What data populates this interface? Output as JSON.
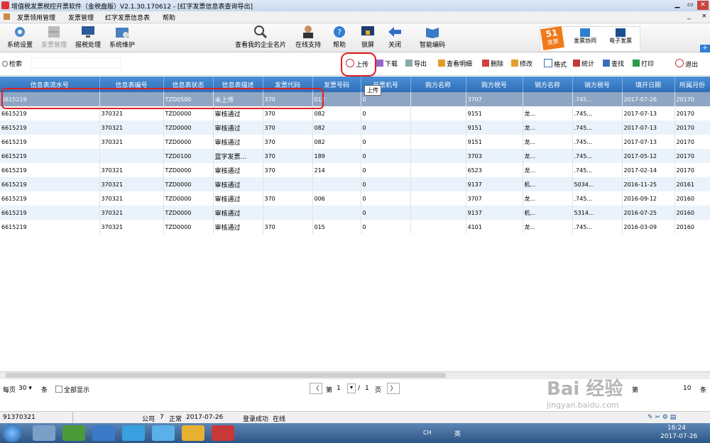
{
  "window": {
    "title": "增值税发票税控开票软件（金税盘版）V2.1.30.170612 - [红字发票信息表查询导出]"
  },
  "menu": [
    "发票领用管理",
    "发票管理",
    "红字发票信息表",
    "帮助"
  ],
  "toolbar": {
    "items": [
      "系统设置",
      "发票管理",
      "报税处理",
      "系统维护"
    ],
    "company_lookup": "查看我的企业名片",
    "right_items": [
      "在线支持",
      "帮助",
      "锁屏",
      "关闭",
      "智能编码"
    ],
    "promo": {
      "badge": "51",
      "badge_sub": "发票",
      "items": [
        "发票协同",
        "电子发票"
      ]
    }
  },
  "search": {
    "label": "检索"
  },
  "actions": {
    "upload": "上传",
    "download": "下载",
    "export": "导出",
    "view_detail": "查看明细",
    "delete": "删除",
    "edit": "修改",
    "format": "格式",
    "stats": "统计",
    "find": "查找",
    "print": "打印",
    "exit": "退出"
  },
  "tooltip": "上传",
  "table": {
    "columns": [
      "信息表流水号",
      "信息表编号",
      "信息表状态",
      "信息表描述",
      "发票代码",
      "发票号码",
      "开票机号",
      "购方名称",
      "购方税号",
      "销方名称",
      "销方税号",
      "填开日期",
      "所属月份"
    ],
    "rows": [
      [
        "6615219",
        "",
        "TZD0500",
        "未上传",
        "370",
        "012",
        "0",
        "",
        "3707",
        "",
        ".745...",
        "2017-07-26",
        "20170"
      ],
      [
        "6615219",
        "370321",
        "TZD0000",
        "审核通过",
        "370",
        "082",
        "0",
        "",
        "9151",
        "龙...",
        ".745...",
        "2017-07-13",
        "20170"
      ],
      [
        "6615219",
        "370321",
        "TZD0000",
        "审核通过",
        "370",
        "082",
        "0",
        "",
        "9151",
        "龙...",
        ".745...",
        "2017-07-13",
        "20170"
      ],
      [
        "6615219",
        "370321",
        "TZD0000",
        "审核通过",
        "370",
        "082",
        "0",
        "",
        "9151",
        "龙...",
        ".745...",
        "2017-07-13",
        "20170"
      ],
      [
        "6615219",
        "",
        "TZD0100",
        "蓝字发票...",
        "370",
        "189",
        "0",
        "",
        "3703",
        "龙...",
        ".745...",
        "2017-05-12",
        "20170"
      ],
      [
        "6615219",
        "370321",
        "TZD0000",
        "审核通过",
        "370",
        "214",
        "0",
        "",
        "6523",
        "龙...",
        ".745...",
        "2017-02-14",
        "20170"
      ],
      [
        "6615219",
        "370321",
        "TZD0000",
        "审核通过",
        "",
        "",
        "0",
        "",
        "9137",
        "机...",
        "5034...",
        "2016-11-25",
        "20161"
      ],
      [
        "6615219",
        "370321",
        "TZD0000",
        "审核通过",
        "370",
        "006",
        "0",
        "",
        "3707",
        "龙...",
        ".745...",
        "2016-09-12",
        "20160"
      ],
      [
        "6615219",
        "370321",
        "TZD0000",
        "审核通过",
        "",
        "",
        "0",
        "",
        "9137",
        "机...",
        "5314...",
        "2016-07-25",
        "20160"
      ],
      [
        "6615219",
        "370321",
        "TZD0000",
        "审核通过",
        "370",
        "015",
        "0",
        "",
        "4101",
        "龙...",
        ".745...",
        "2016-03-09",
        "20160"
      ]
    ]
  },
  "pager": {
    "per_page_label": "每页",
    "per_page": "30",
    "unit": "条",
    "show_all": "全部显示",
    "page_label": "第",
    "current_page": "1",
    "separator": "/",
    "total_pages": "1",
    "page_unit": "页",
    "right_label": "第",
    "right_value": "10",
    "right_unit": "条"
  },
  "status": {
    "tax_id": "91370321",
    "company": "公司",
    "num": "7",
    "state": "正常",
    "date": "2017-07-26",
    "login": "登录成功",
    "online": "在线"
  },
  "taskbar": {
    "time": "16:24",
    "date": "2017-07-26",
    "lang": "CH",
    "ime": "英"
  },
  "watermark": {
    "text": "Bai 经验",
    "url": "jingyan.baidu.com"
  }
}
